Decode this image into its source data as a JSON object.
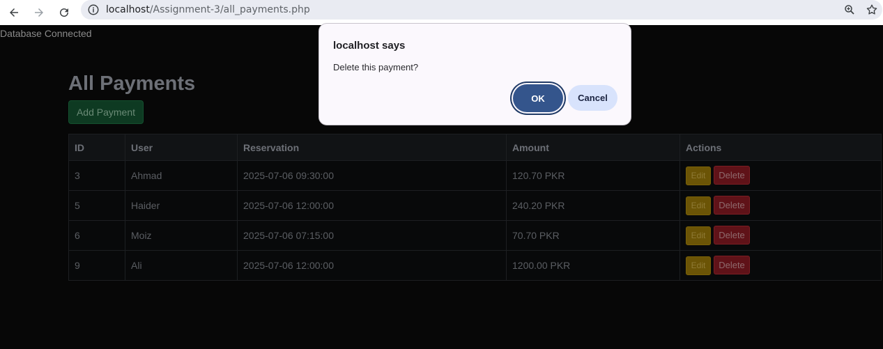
{
  "browser": {
    "url_host": "localhost",
    "url_path": "/Assignment-3/all_payments.php",
    "icons": [
      "back-icon",
      "forward-icon",
      "reload-icon",
      "info-icon",
      "zoom-icon",
      "bookmark-star-icon"
    ]
  },
  "page": {
    "db_status": "Database Connected",
    "title": "All Payments",
    "add_button": "Add Payment",
    "table": {
      "headers": [
        "ID",
        "User",
        "Reservation",
        "Amount",
        "Actions"
      ],
      "rows": [
        {
          "id": "3",
          "user": "Ahmad",
          "reservation": "2025-07-06 09:30:00",
          "amount": "120.70 PKR"
        },
        {
          "id": "5",
          "user": "Haider",
          "reservation": "2025-07-06 12:00:00",
          "amount": "240.20 PKR"
        },
        {
          "id": "6",
          "user": "Moiz",
          "reservation": "2025-07-06 07:15:00",
          "amount": "70.70 PKR"
        },
        {
          "id": "9",
          "user": "Ali",
          "reservation": "2025-07-06 12:00:00",
          "amount": "1200.00 PKR"
        }
      ],
      "edit_label": "Edit",
      "delete_label": "Delete"
    }
  },
  "dialog": {
    "title": "localhost says",
    "message": "Delete this payment?",
    "ok_label": "OK",
    "cancel_label": "Cancel"
  },
  "colors": {
    "page_bg": "#070707",
    "dialog_ok": "#34558c",
    "dialog_cancel": "#d8e3fc",
    "edit_btn": "#6b5406",
    "delete_btn": "#5f1218",
    "add_btn": "#0e3a22"
  }
}
